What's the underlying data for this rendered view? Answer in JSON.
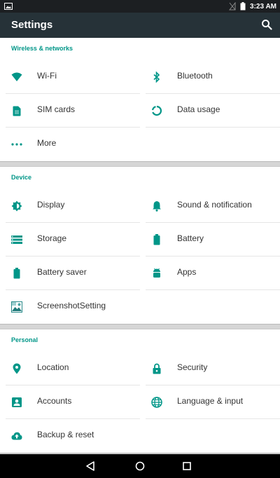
{
  "status_bar": {
    "time": "3:23 AM",
    "icons": [
      "image-icon",
      "signal-off-icon",
      "battery-icon"
    ]
  },
  "toolbar": {
    "title": "Settings",
    "search_icon": "search-icon"
  },
  "colors": {
    "accent": "#009688",
    "toolbar": "#263238",
    "status_bar": "#1c1f22",
    "icon": "#009688"
  },
  "sections": [
    {
      "title": "Wireless & networks",
      "items": [
        {
          "label": "Wi-Fi",
          "icon": "wifi-icon"
        },
        {
          "label": "Bluetooth",
          "icon": "bluetooth-icon"
        },
        {
          "label": "SIM cards",
          "icon": "sim-card-icon"
        },
        {
          "label": "Data usage",
          "icon": "data-usage-icon"
        },
        {
          "label": "More",
          "icon": "more-icon"
        }
      ]
    },
    {
      "title": "Device",
      "items": [
        {
          "label": "Display",
          "icon": "display-icon"
        },
        {
          "label": "Sound & notification",
          "icon": "bell-icon"
        },
        {
          "label": "Storage",
          "icon": "storage-icon"
        },
        {
          "label": "Battery",
          "icon": "battery-icon"
        },
        {
          "label": "Battery saver",
          "icon": "battery-saver-icon"
        },
        {
          "label": "Apps",
          "icon": "android-icon"
        },
        {
          "label": "ScreenshotSetting",
          "icon": "screenshot-icon"
        }
      ]
    },
    {
      "title": "Personal",
      "items": [
        {
          "label": "Location",
          "icon": "location-icon"
        },
        {
          "label": "Security",
          "icon": "lock-icon"
        },
        {
          "label": "Accounts",
          "icon": "account-icon"
        },
        {
          "label": "Language & input",
          "icon": "globe-icon"
        },
        {
          "label": "Backup & reset",
          "icon": "cloud-upload-icon"
        }
      ]
    }
  ],
  "nav_bar": {
    "buttons": [
      "back-icon",
      "home-icon",
      "recents-icon"
    ]
  }
}
